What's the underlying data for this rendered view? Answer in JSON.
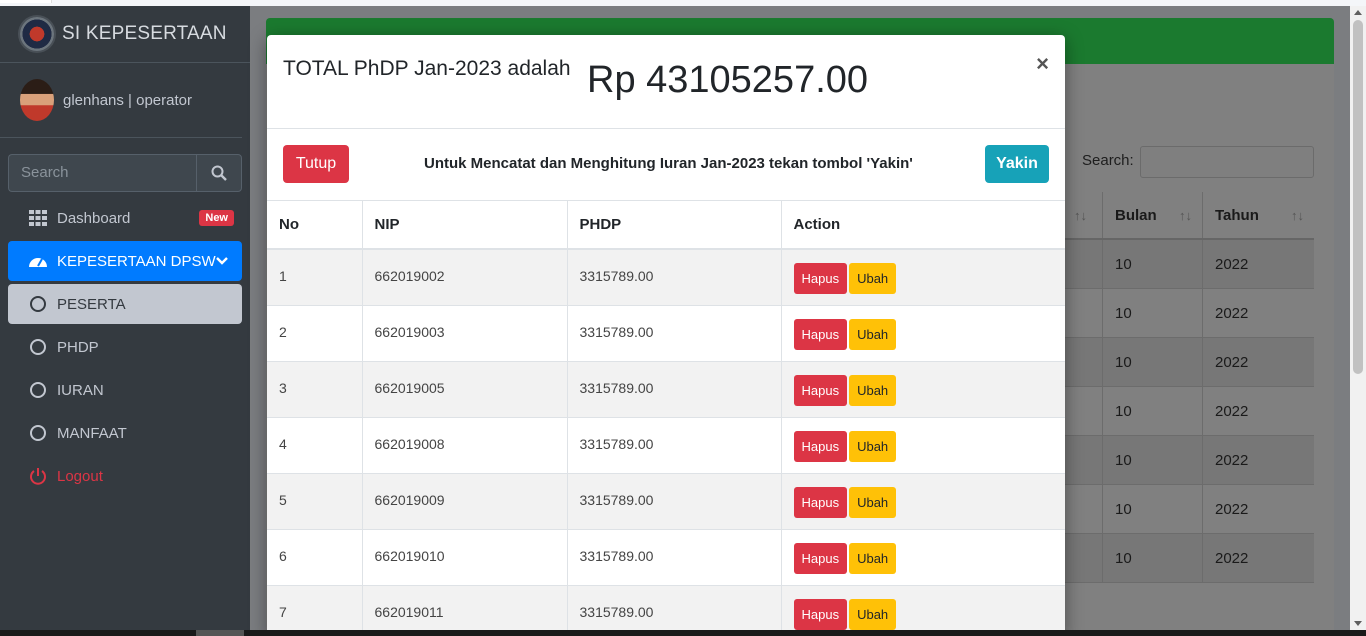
{
  "app": {
    "brand": "SI KEPESERTAAN",
    "user": "glenhans | operator"
  },
  "sidebar": {
    "search_placeholder": "Search",
    "items": [
      {
        "label": "Dashboard",
        "badge": "New"
      },
      {
        "label": "KEPESERTAAN DPSW"
      },
      {
        "label": "PESERTA"
      },
      {
        "label": "PHDP"
      },
      {
        "label": "IURAN"
      },
      {
        "label": "MANFAAT"
      },
      {
        "label": "Logout"
      }
    ]
  },
  "background": {
    "search_label": "Search:",
    "columns": [
      "Bulan",
      "Tahun"
    ],
    "rows": [
      [
        "10",
        "2022"
      ],
      [
        "10",
        "2022"
      ],
      [
        "10",
        "2022"
      ],
      [
        "10",
        "2022"
      ],
      [
        "10",
        "2022"
      ],
      [
        "10",
        "2022"
      ],
      [
        "10",
        "2022"
      ]
    ]
  },
  "modal": {
    "title": "TOTAL PhDP Jan-2023 adalah",
    "amount": "Rp 43105257.00",
    "close": "×",
    "tutup": "Tutup",
    "message": "Untuk Mencatat dan Menghitung Iuran Jan-2023 tekan tombol 'Yakin'",
    "yakin": "Yakin",
    "columns": [
      "No",
      "NIP",
      "PHDP",
      "Action"
    ],
    "delete_label": "Hapus",
    "edit_label": "Ubah",
    "rows": [
      {
        "no": "1",
        "nip": "662019002",
        "phdp": "3315789.00"
      },
      {
        "no": "2",
        "nip": "662019003",
        "phdp": "3315789.00"
      },
      {
        "no": "3",
        "nip": "662019005",
        "phdp": "3315789.00"
      },
      {
        "no": "4",
        "nip": "662019008",
        "phdp": "3315789.00"
      },
      {
        "no": "5",
        "nip": "662019009",
        "phdp": "3315789.00"
      },
      {
        "no": "6",
        "nip": "662019010",
        "phdp": "3315789.00"
      },
      {
        "no": "7",
        "nip": "662019011",
        "phdp": "3315789.00"
      }
    ]
  },
  "colors": {
    "sidebar": "#343a40",
    "active_nav": "#007bff",
    "danger": "#dc3545",
    "warning": "#ffc107",
    "info": "#17a2b8",
    "card_header": "#28a745"
  }
}
